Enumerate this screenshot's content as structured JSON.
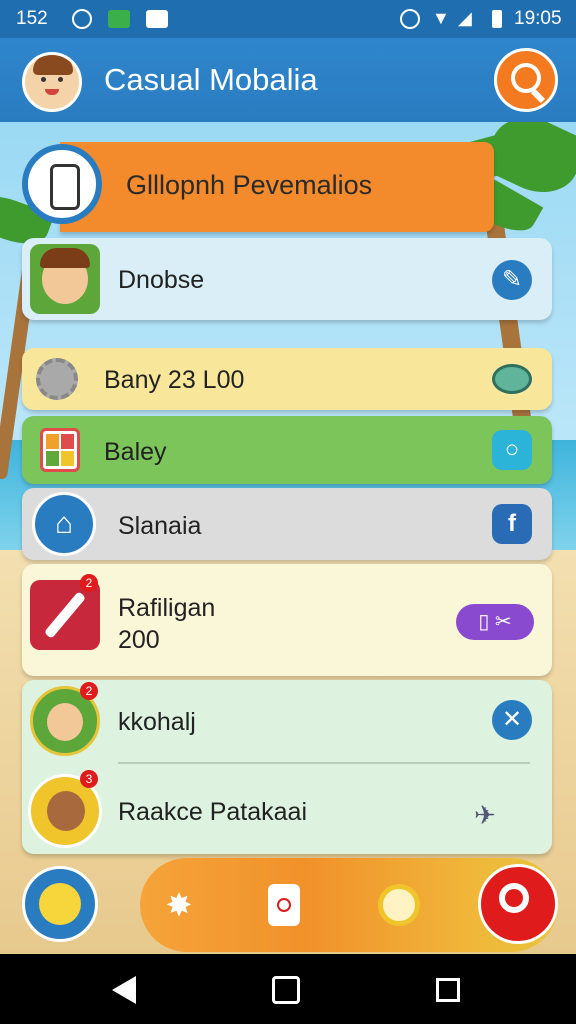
{
  "status_bar": {
    "left_text": "152",
    "time": "19:05"
  },
  "app_bar": {
    "title": "Casual Mobalia"
  },
  "banner": {
    "title": "Glllopnh Pevemalios"
  },
  "list": [
    {
      "label": "Dnobse",
      "line2": "",
      "right_icon": "pencil-icon"
    },
    {
      "label": "Bany 23 L00",
      "line2": "",
      "right_icon": "hat-icon"
    },
    {
      "label": "Baley",
      "line2": "",
      "right_icon": "search-icon"
    },
    {
      "label": "Slanaia",
      "line2": "",
      "right_icon": "facebook-icon"
    },
    {
      "label": "Rafiligan",
      "line2": "200",
      "right_icon": "toggle-icon"
    },
    {
      "label": "kkohalj",
      "line2": "",
      "right_icon": "close-icon"
    },
    {
      "label": "Raakce Patakaai",
      "line2": "",
      "right_icon": "plane-icon"
    }
  ],
  "badges": {
    "item5": "2",
    "item6": "2",
    "item7": "3"
  },
  "colors": {
    "appbar": "#2a7cc0",
    "accent_orange": "#f47a1f",
    "banner": "#f38a2c",
    "danger": "#e01b1b"
  }
}
